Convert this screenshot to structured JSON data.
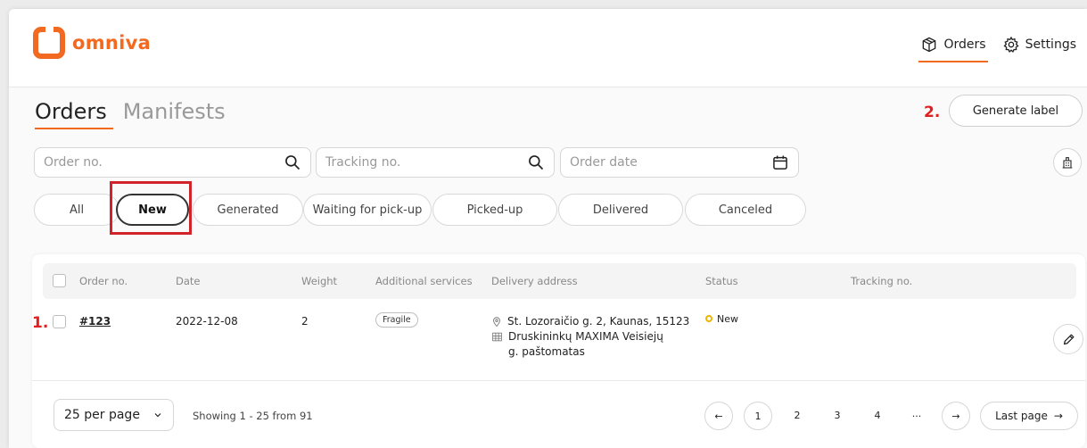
{
  "brand": {
    "name": "omniva",
    "color": "#f26a21"
  },
  "topnav": [
    {
      "label": "Orders",
      "icon": "box-icon",
      "active": true
    },
    {
      "label": "Settings",
      "icon": "gear-icon",
      "active": false
    }
  ],
  "page_tabs": [
    {
      "label": "Orders",
      "active": true
    },
    {
      "label": "Manifests",
      "active": false
    }
  ],
  "annotations": {
    "step1": "1.",
    "step2": "2."
  },
  "actions": {
    "generate_label": "Generate label"
  },
  "filters": {
    "order_no_placeholder": "Order no.",
    "tracking_placeholder": "Tracking no.",
    "date_placeholder": "Order date"
  },
  "status_tabs": [
    {
      "label": "All"
    },
    {
      "label": "New",
      "active": true
    },
    {
      "label": "Generated"
    },
    {
      "label": "Waiting for pick-up"
    },
    {
      "label": "Picked-up"
    },
    {
      "label": "Delivered"
    },
    {
      "label": "Canceled"
    }
  ],
  "table": {
    "columns": [
      "Order no.",
      "Date",
      "Weight",
      "Additional services",
      "Delivery address",
      "Status",
      "Tracking no."
    ],
    "rows": [
      {
        "order_no": "#123",
        "date": "2022-12-08",
        "weight": "2",
        "service": "Fragile",
        "address_line": "St. Lozoraičio g. 2, Kaunas, 15123",
        "terminal_line1": "Druskininkų MAXIMA Veisiejų",
        "terminal_line2": "g. paštomatas",
        "status": "New",
        "tracking_no": ""
      }
    ]
  },
  "pagination": {
    "per_page": "25 per page",
    "showing": "Showing 1 - 25 from 91",
    "pages": [
      "1",
      "2",
      "3",
      "4",
      "..."
    ],
    "current": "1",
    "last_page": "Last page",
    "prev_arrow": "←",
    "next_arrow": "→"
  }
}
